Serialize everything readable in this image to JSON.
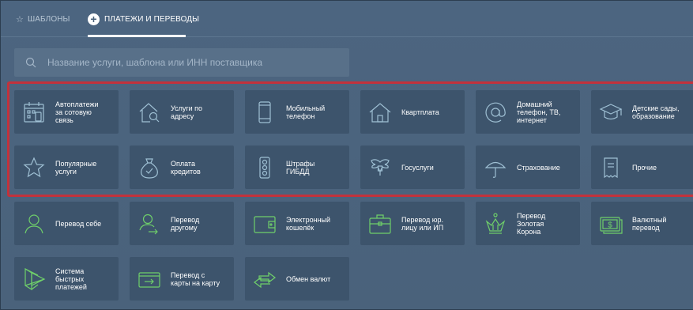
{
  "tabs": {
    "templates_label": "ШАБЛОНЫ",
    "payments_label": "ПЛАТЕЖИ И ПЕРЕВОДЫ"
  },
  "search": {
    "placeholder": "Название услуги, шаблона или ИНН поставщика"
  },
  "payments": [
    {
      "label": "Автоплатежи\nза сотовую\nсвязь",
      "icon": "autopay-calendar-icon"
    },
    {
      "label": "Услуги по\nадресу",
      "icon": "house-search-icon"
    },
    {
      "label": "Мобильный\nтелефон",
      "icon": "mobile-phone-icon"
    },
    {
      "label": "Квартплата",
      "icon": "house-icon"
    },
    {
      "label": "Домашний\nтелефон, ТВ,\nинтернет",
      "icon": "at-sign-icon"
    },
    {
      "label": "Детские сады,\nобразование",
      "icon": "graduation-cap-icon"
    },
    {
      "label": "Популярные\nуслуги",
      "icon": "star-icon"
    },
    {
      "label": "Оплата\nкредитов",
      "icon": "money-bag-icon"
    },
    {
      "label": "Штрафы\nГИБДД",
      "icon": "traffic-light-icon"
    },
    {
      "label": "Госуслуги",
      "icon": "coat-of-arms-icon"
    },
    {
      "label": "Страхование",
      "icon": "umbrella-icon"
    },
    {
      "label": "Прочие",
      "icon": "receipt-icon"
    }
  ],
  "transfers": [
    {
      "label": "Перевод себе",
      "icon": "person-icon"
    },
    {
      "label": "Перевод\nдругому",
      "icon": "person-transfer-icon"
    },
    {
      "label": "Электронный\nкошелёк",
      "icon": "wallet-icon"
    },
    {
      "label": "Перевод юр.\nлицу или ИП",
      "icon": "briefcase-icon"
    },
    {
      "label": "Перевод\nЗолотая\nКорона",
      "icon": "crown-icon"
    },
    {
      "label": "Валютный\nперевод",
      "icon": "banknote-icon"
    },
    {
      "label": "Система\nбыстрых\nплатежей",
      "icon": "sbp-logo-icon"
    },
    {
      "label": "Перевод с\nкарты на карту",
      "icon": "card-transfer-icon"
    },
    {
      "label": "Обмен валют",
      "icon": "exchange-arrows-icon"
    }
  ],
  "colors": {
    "background": "#4a627a",
    "tile": "#3d546c",
    "icon_blue": "#9fc0d4",
    "icon_green": "#6fcf6a",
    "highlight_red": "#c2323c"
  }
}
